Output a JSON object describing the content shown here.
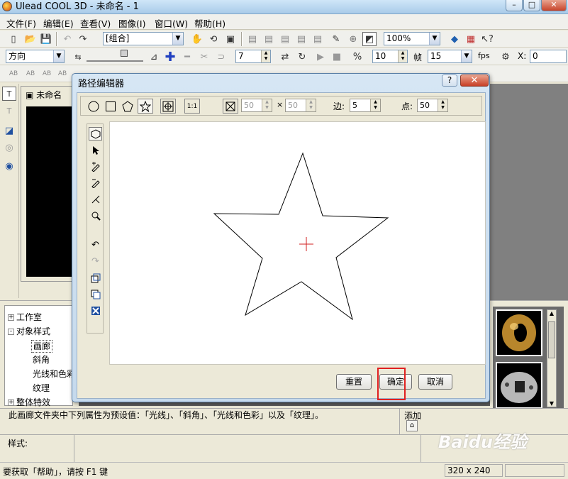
{
  "window": {
    "title": "Ulead COOL 3D - 未命名 - 1",
    "controls": {
      "minimize": "–",
      "maximize": "□",
      "close": "✕"
    }
  },
  "menu": [
    "文件(F)",
    "编辑(E)",
    "查看(V)",
    "图像(I)",
    "窗口(W)",
    "帮助(H)"
  ],
  "toolbar1": {
    "group_combo": "[组合]",
    "zoom_combo": "100%"
  },
  "toolbar2": {
    "direction_combo": "方向",
    "frame_value": "7",
    "total_frames": "10",
    "frame_label": "帧",
    "fps_value": "15",
    "fps_label": "fps",
    "x_label": "X:",
    "x_value": "0"
  },
  "document": {
    "tab_title": "未命名"
  },
  "tree": {
    "items": [
      {
        "label": "工作室",
        "expander": "+"
      },
      {
        "label": "对象样式",
        "expander": "-"
      },
      {
        "label": "画廊",
        "selected": true
      },
      {
        "label": "斜角"
      },
      {
        "label": "光线和色彩"
      },
      {
        "label": "纹理"
      },
      {
        "label": "整体特效",
        "expander": "+"
      }
    ]
  },
  "description": {
    "text": "此画廊文件夹中下列属性为预设值：「光线」、「斜角」、「光线和色彩」以及「纹理」。",
    "style_label": "样式:",
    "add_label": "添加"
  },
  "status": {
    "help_text": "要获取「帮助」，请按 F1 键",
    "resolution": "320 x 240"
  },
  "watermark": "Baidu经验",
  "dialog": {
    "title": "路径编辑器",
    "help": "?",
    "close": "✕",
    "width_value": "50",
    "times": "×",
    "height_value": "50",
    "sides_label": "边:",
    "sides_value": "5",
    "points_label": "点:",
    "points_value": "50",
    "reset_button": "重置",
    "ok_button": "确定",
    "cancel_button": "取消"
  },
  "colors": {
    "highlight": "#e02020",
    "crosshair": "#d02020"
  }
}
